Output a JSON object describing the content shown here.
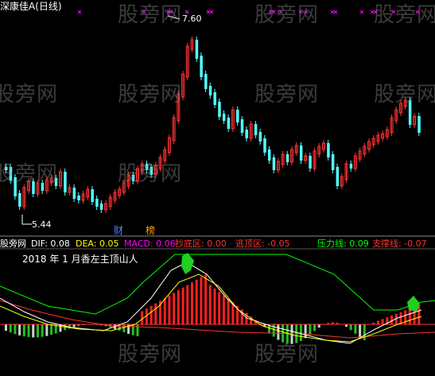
{
  "top_panel": {
    "title": "深康佳A(日线)",
    "high_label": "7.60",
    "low_label": "5.44",
    "badge_cai": "财",
    "badge_bang": "榜"
  },
  "indicator_bar": {
    "name": "股旁网",
    "dif": "DIF: 0.08",
    "dea": "DEA: 0.05",
    "macd": "MACD: 0.06",
    "chaodi": "抄底区: 0.00",
    "taoding": "逃顶区: -0.05",
    "yali": "压力线: 0.09",
    "zhicheng": "支撑线: -0.07"
  },
  "annotation": "2018 年 1 月香左主顶山人",
  "watermarks": [
    "股旁网",
    "股旁网",
    "股旁网",
    "股旁网",
    "股旁网",
    "股旁网",
    "股旁网",
    "股旁网",
    "股旁网",
    "股旁网",
    "股旁网"
  ],
  "colors": {
    "up_candle": "#ff3232",
    "down_candle": "#54ffff",
    "title": "#ffffff",
    "dif": "#ffffff",
    "dea": "#ffff00",
    "macd": "#ff00ff",
    "chaodi": "#ff3232",
    "taoding": "#ff3232",
    "yali": "#00ff00",
    "zhicheng": "#ff3232",
    "annotation": "#ffffff",
    "badge_cai": "#4a8cff",
    "badge_bang": "#ffa000",
    "marker": "#ff00ff"
  }
}
